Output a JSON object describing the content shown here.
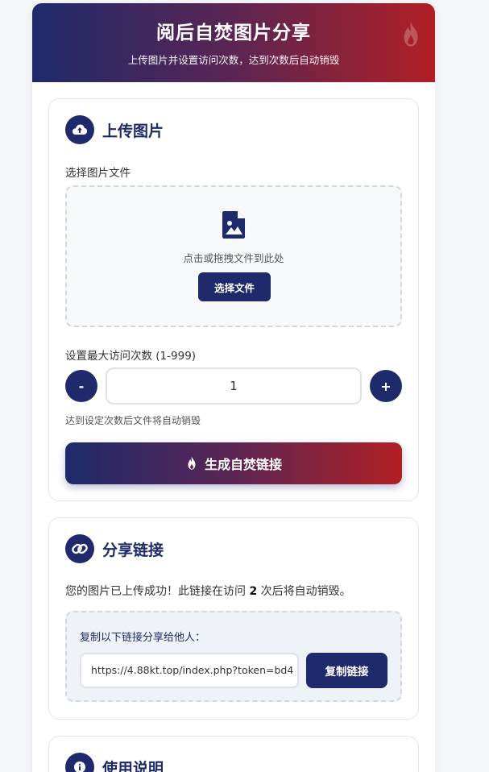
{
  "header": {
    "title": "阅后自焚图片分享",
    "subtitle": "上传图片并设置访问次数，达到次数后自动销毁"
  },
  "upload": {
    "title": "上传图片",
    "file_label": "选择图片文件",
    "drop_hint": "点击或拖拽文件到此处",
    "select_button": "选择文件",
    "count_label": "设置最大访问次数 (1-999)",
    "minus_label": "-",
    "plus_label": "+",
    "count_value": "1",
    "count_help": "达到设定次数后文件将自动销毁",
    "generate_button": "生成自焚链接"
  },
  "share": {
    "title": "分享链接",
    "message_prefix": "您的图片已上传成功！此链接在访问",
    "message_count": "2",
    "message_suffix": "次后将自动销毁。",
    "copy_label": "复制以下链接分享给他人：",
    "link_value": "https://4.88kt.top/index.php?token=bd4",
    "copy_button": "复制链接"
  },
  "help": {
    "title": "使用说明"
  },
  "colors": {
    "primary": "#1e2a6b",
    "accent_red": "#b11f24",
    "page_bg": "#f4f5f8"
  },
  "icons": {
    "header": "fire-icon",
    "upload": "cloud-upload-icon",
    "dropzone": "image-file-icon",
    "generate": "fire-icon",
    "share": "link-icon",
    "help": "info-icon"
  }
}
